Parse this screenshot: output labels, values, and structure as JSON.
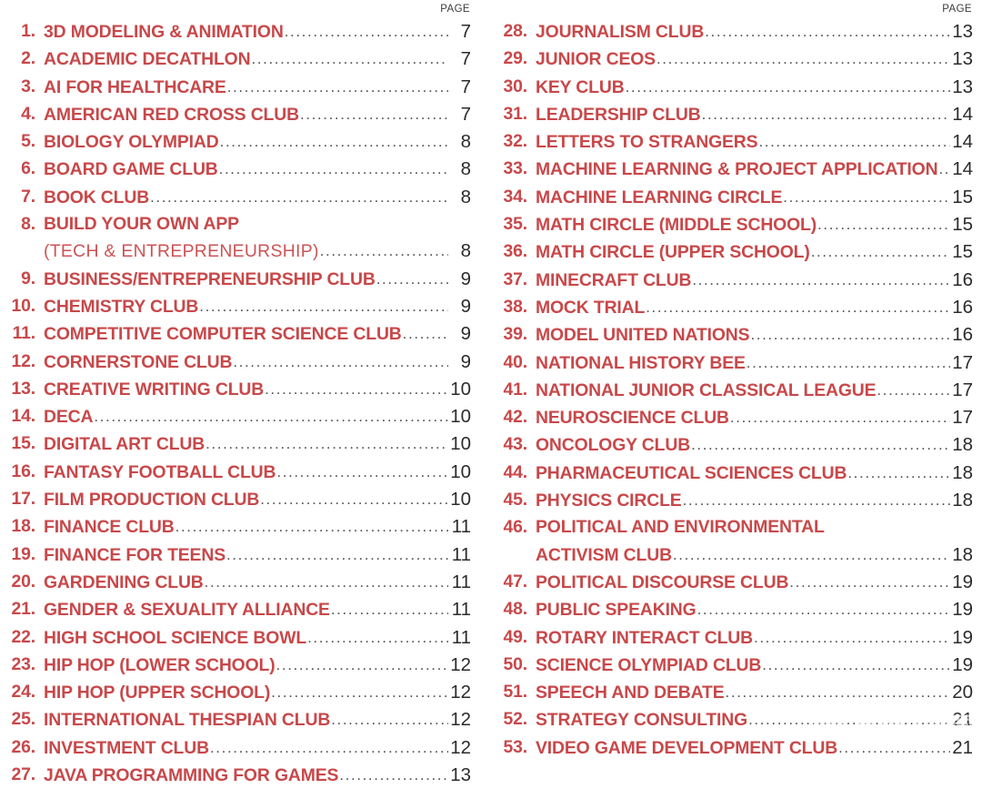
{
  "document": {
    "background_color": "#ffffff",
    "accent_color": "#c8484a",
    "page_number_color": "#2b2b2b",
    "leader_color": "#555555"
  },
  "columns": [
    {
      "id": "left",
      "page_header": "PAGE",
      "entries": [
        {
          "num": "1.",
          "title": "3D MODELING & ANIMATION",
          "page": "7"
        },
        {
          "num": "2.",
          "title": "ACADEMIC DECATHLON",
          "page": "7"
        },
        {
          "num": "3.",
          "title": "AI FOR HEALTHCARE",
          "page": "7"
        },
        {
          "num": "4.",
          "title": "AMERICAN RED CROSS CLUB",
          "page": "7"
        },
        {
          "num": "5.",
          "title": "BIOLOGY OLYMPIAD",
          "page": "8"
        },
        {
          "num": "6.",
          "title": "BOARD GAME CLUB",
          "page": "8"
        },
        {
          "num": "7.",
          "title": "BOOK CLUB",
          "page": "8"
        },
        {
          "num": "8.",
          "title": "BUILD YOUR OWN APP",
          "title2": "(TECH & ENTREPRENEURSHIP)",
          "title2_style": "light",
          "page": "8"
        },
        {
          "num": "9.",
          "title": "BUSINESS/ENTREPRENEURSHIP CLUB",
          "page": "9"
        },
        {
          "num": "10.",
          "title": "CHEMISTRY CLUB",
          "page": "9"
        },
        {
          "num": "11.",
          "title": "COMPETITIVE COMPUTER SCIENCE CLUB",
          "page": "9"
        },
        {
          "num": "12.",
          "title": "CORNERSTONE CLUB",
          "page": "9"
        },
        {
          "num": "13.",
          "title": "CREATIVE WRITING CLUB",
          "page": "10"
        },
        {
          "num": "14.",
          "title": "DECA",
          "page": "10"
        },
        {
          "num": "15.",
          "title": "DIGITAL ART CLUB",
          "page": "10"
        },
        {
          "num": "16.",
          "title": "FANTASY FOOTBALL CLUB",
          "page": "10"
        },
        {
          "num": "17.",
          "title": "FILM PRODUCTION CLUB",
          "page": "10"
        },
        {
          "num": "18.",
          "title": "FINANCE CLUB",
          "page": "11"
        },
        {
          "num": "19.",
          "title": "FINANCE FOR TEENS",
          "page": "11"
        },
        {
          "num": "20.",
          "title": "GARDENING CLUB",
          "page": "11"
        },
        {
          "num": "21.",
          "title": "GENDER & SEXUALITY ALLIANCE",
          "page": "11"
        },
        {
          "num": "22.",
          "title": "HIGH SCHOOL SCIENCE BOWL",
          "page": "11"
        },
        {
          "num": "23.",
          "title": "HIP HOP (LOWER SCHOOL)",
          "page": "12"
        },
        {
          "num": "24.",
          "title": "HIP HOP (UPPER SCHOOL)",
          "page": "12"
        },
        {
          "num": "25.",
          "title": "INTERNATIONAL THESPIAN CLUB",
          "page": "12"
        },
        {
          "num": "26.",
          "title": "INVESTMENT CLUB",
          "page": "12"
        },
        {
          "num": "27.",
          "title": "JAVA PROGRAMMING FOR GAMES",
          "page": "13"
        }
      ]
    },
    {
      "id": "right",
      "page_header": "PAGE",
      "entries": [
        {
          "num": "28.",
          "title": "JOURNALISM CLUB",
          "page": "13"
        },
        {
          "num": "29.",
          "title": "JUNIOR CEOS",
          "page": "13"
        },
        {
          "num": "30.",
          "title": "KEY CLUB",
          "page": "13"
        },
        {
          "num": "31.",
          "title": "LEADERSHIP CLUB",
          "page": "14"
        },
        {
          "num": "32.",
          "title": "LETTERS TO STRANGERS",
          "page": "14"
        },
        {
          "num": "33.",
          "title": "MACHINE LEARNING & PROJECT APPLICATION",
          "page": "14"
        },
        {
          "num": "34.",
          "title": "MACHINE LEARNING CIRCLE",
          "page": "15"
        },
        {
          "num": "35.",
          "title": "MATH CIRCLE (MIDDLE SCHOOL)",
          "page": "15"
        },
        {
          "num": "36.",
          "title": "MATH CIRCLE (UPPER SCHOOL)",
          "page": "15"
        },
        {
          "num": "37.",
          "title": "MINECRAFT CLUB",
          "page": "16"
        },
        {
          "num": "38.",
          "title": "MOCK TRIAL",
          "page": "16"
        },
        {
          "num": "39.",
          "title": "MODEL UNITED NATIONS",
          "page": "16"
        },
        {
          "num": "40.",
          "title": "NATIONAL HISTORY BEE",
          "page": "17"
        },
        {
          "num": "41.",
          "title": "NATIONAL JUNIOR CLASSICAL LEAGUE",
          "page": "17"
        },
        {
          "num": "42.",
          "title": "NEUROSCIENCE CLUB",
          "page": "17"
        },
        {
          "num": "43.",
          "title": "ONCOLOGY CLUB",
          "page": "18"
        },
        {
          "num": "44.",
          "title": "PHARMACEUTICAL SCIENCES CLUB",
          "page": "18"
        },
        {
          "num": "45.",
          "title": "PHYSICS CIRCLE",
          "page": "18"
        },
        {
          "num": "46.",
          "title": "POLITICAL AND ENVIRONMENTAL",
          "title2": "ACTIVISM CLUB",
          "title2_style": "bold",
          "page": "18"
        },
        {
          "num": "47.",
          "title": "POLITICAL DISCOURSE CLUB",
          "page": "19"
        },
        {
          "num": "48.",
          "title": "PUBLIC SPEAKING",
          "page": "19"
        },
        {
          "num": "49.",
          "title": "ROTARY INTERACT CLUB",
          "page": "19"
        },
        {
          "num": "50.",
          "title": "SCIENCE OLYMPIAD CLUB",
          "page": "19"
        },
        {
          "num": "51.",
          "title": "SPEECH AND DEBATE",
          "page": "20"
        },
        {
          "num": "52.",
          "title": "STRATEGY CONSULTING",
          "page": "21"
        },
        {
          "num": "53.",
          "title": "VIDEO GAME DEVELOPMENT CLUB",
          "page": "21"
        }
      ]
    }
  ],
  "watermark": {
    "text": "憨爸在美国",
    "icon": "wechat-bubbles-icon"
  }
}
